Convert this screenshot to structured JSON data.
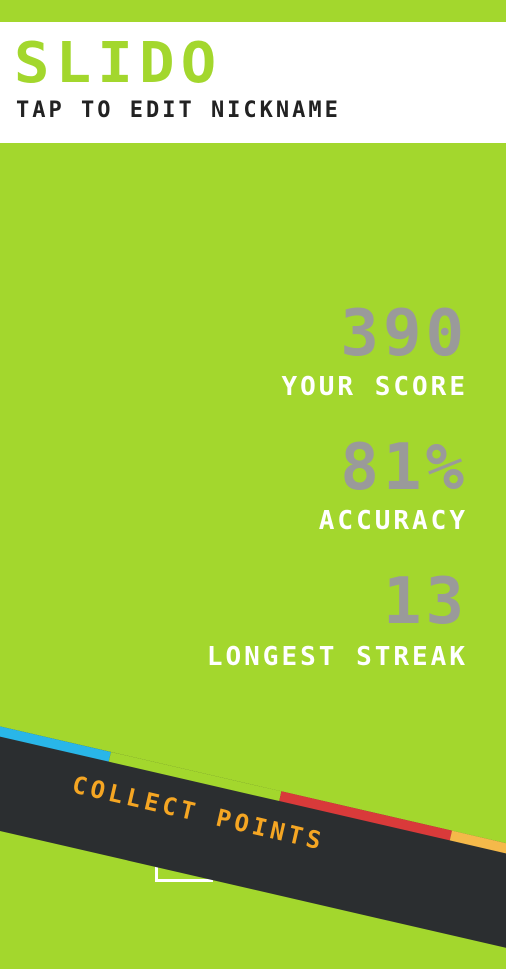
{
  "header": {
    "title": "SLIDO",
    "nickname_hint": "TAP TO EDIT NICKNAME"
  },
  "stats": {
    "score": {
      "value": "390",
      "label": "YOUR SCORE"
    },
    "accuracy": {
      "value": "81%",
      "label": "ACCURACY"
    },
    "streak": {
      "value": "13",
      "label": "LONGEST STREAK"
    }
  },
  "banner": {
    "text": "COLLECT POINTS"
  },
  "colors": {
    "background": "#a3d72d",
    "title_green": "#a3d72d",
    "value_gray": "#9a9a9a",
    "label_white": "#ffffff",
    "banner_dark": "#2b2e30",
    "banner_text": "#f5a623",
    "stripe": [
      "#29b6e8",
      "#a3d72d",
      "#d93a3a",
      "#f5b94a"
    ]
  }
}
